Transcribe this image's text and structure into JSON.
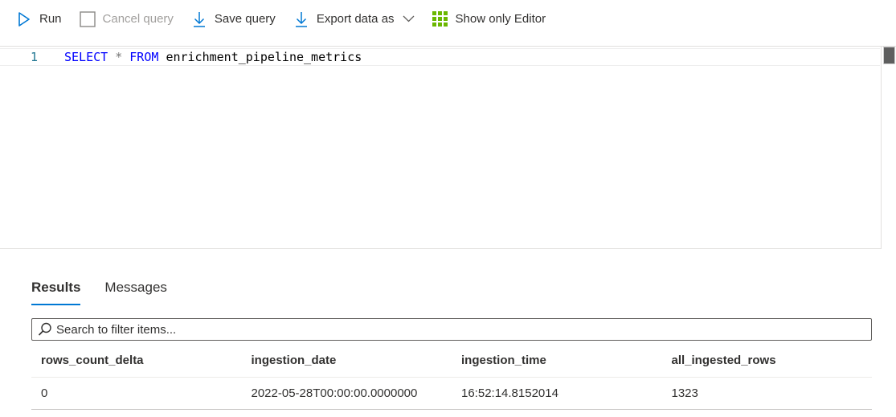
{
  "toolbar": {
    "run_label": "Run",
    "cancel_label": "Cancel query",
    "save_label": "Save query",
    "export_label": "Export data as",
    "editor_only_label": "Show only Editor"
  },
  "editor": {
    "line_number": "1",
    "keyword_select": "SELECT",
    "operator": "*",
    "keyword_from": "FROM",
    "table_name": "enrichment_pipeline_metrics"
  },
  "results": {
    "tabs": [
      {
        "label": "Results",
        "active": true
      },
      {
        "label": "Messages",
        "active": false
      }
    ],
    "filter_placeholder": "Search to filter items...",
    "columns": [
      "rows_count_delta",
      "ingestion_date",
      "ingestion_time",
      "all_ingested_rows"
    ],
    "rows": [
      [
        "0",
        "2022-05-28T00:00:00.0000000",
        "16:52:14.8152014",
        "1323"
      ]
    ]
  },
  "colors": {
    "accent": "#0078d4",
    "grid_icon": "#6bb700",
    "keyword": "#0000ff",
    "line_number": "#237893"
  },
  "icons": [
    "run-icon",
    "cancel-checkbox-icon",
    "save-download-icon",
    "export-download-icon",
    "chevron-down-icon",
    "grid-icon",
    "search-icon"
  ]
}
